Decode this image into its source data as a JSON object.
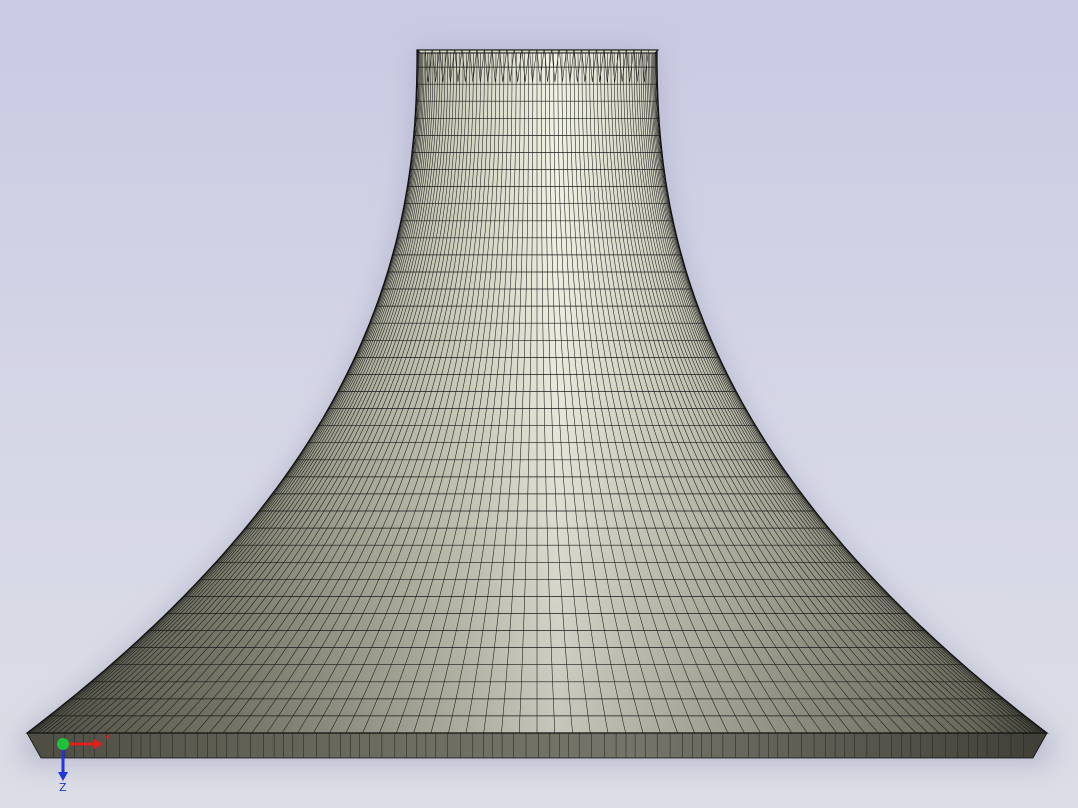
{
  "viewport": {
    "background_top": "#c9cae3",
    "background_bottom": "#dcdde6"
  },
  "model": {
    "surface_color_light": "#eeeedf",
    "surface_color_mid": "#a5a593",
    "surface_color_dark": "#5a5a4e",
    "edge_color": "#111111",
    "mesh": {
      "vertical_rows": 40,
      "radial_segments": 90
    }
  },
  "triad": {
    "x_axis_color": "#e0201a",
    "y_axis_color": "#1fc03a",
    "z_axis_color": "#2436d8",
    "x_label": "Y",
    "z_label": "Z",
    "x_icon": "axis-arrow-icon",
    "y_icon": "axis-sphere-icon",
    "z_icon": "axis-arrow-icon"
  }
}
